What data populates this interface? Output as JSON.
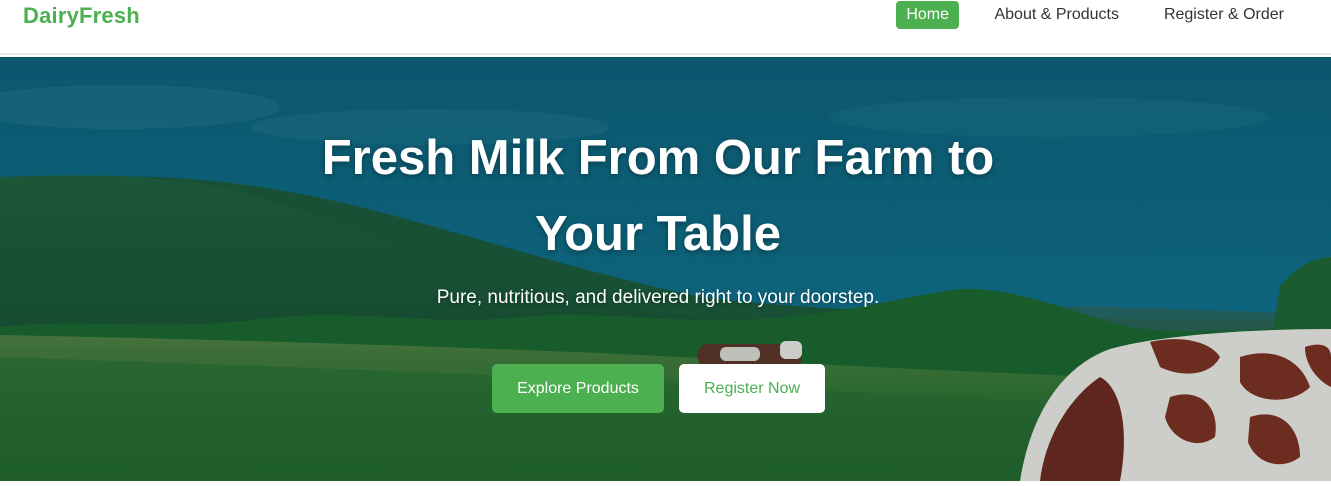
{
  "brand": {
    "name": "DairyFresh"
  },
  "nav": {
    "items": [
      {
        "label": "Home",
        "active": true
      },
      {
        "label": "About & Products",
        "active": false
      },
      {
        "label": "Register & Order",
        "active": false
      }
    ]
  },
  "hero": {
    "title_line1": "Fresh Milk From Our Farm to",
    "title_line2": "Your Table",
    "subtitle": "Pure, nutritious, and delivered right to your doorstep.",
    "primary_button": "Explore Products",
    "secondary_button": "Register Now"
  },
  "colors": {
    "accent": "#4caf50",
    "overlay": "#0a5a78",
    "text_dark": "#333333"
  }
}
